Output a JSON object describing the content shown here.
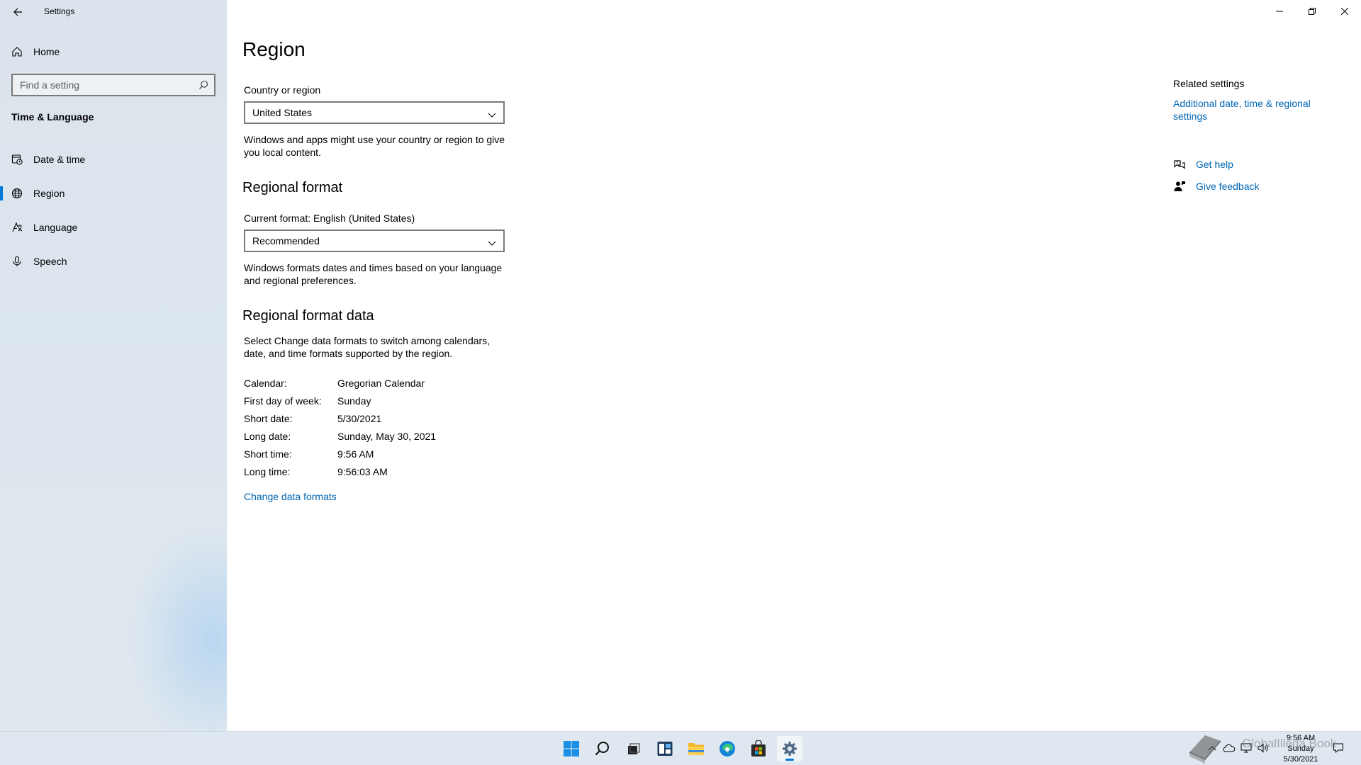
{
  "window": {
    "title": "Settings"
  },
  "sidebar": {
    "home_label": "Home",
    "search_placeholder": "Find a setting",
    "section_title": "Time & Language",
    "items": [
      {
        "label": "Date & time",
        "icon": "calendar-clock-icon"
      },
      {
        "label": "Region",
        "icon": "globe-icon",
        "active": true
      },
      {
        "label": "Language",
        "icon": "language-icon"
      },
      {
        "label": "Speech",
        "icon": "microphone-icon"
      }
    ]
  },
  "main": {
    "title": "Region",
    "country": {
      "label": "Country or region",
      "value": "United States",
      "description": "Windows and apps might use your country or region to give you local content."
    },
    "regional_format": {
      "title": "Regional format",
      "current_label": "Current format: English (United States)",
      "value": "Recommended",
      "description": "Windows formats dates and times based on your language and regional preferences."
    },
    "format_data": {
      "title": "Regional format data",
      "description": "Select Change data formats to switch among calendars, date, and time formats supported by the region.",
      "rows": [
        {
          "key": "Calendar:",
          "value": "Gregorian Calendar"
        },
        {
          "key": "First day of week:",
          "value": "Sunday"
        },
        {
          "key": "Short date:",
          "value": "5/30/2021"
        },
        {
          "key": "Long date:",
          "value": "Sunday, May 30, 2021"
        },
        {
          "key": "Short time:",
          "value": "9:56 AM"
        },
        {
          "key": "Long time:",
          "value": "9:56:03 AM"
        }
      ],
      "change_link": "Change data formats"
    }
  },
  "related": {
    "title": "Related settings",
    "link": "Additional date, time & regional settings",
    "get_help": "Get help",
    "give_feedback": "Give feedback"
  },
  "taskbar": {
    "clock_time": "9:56 AM",
    "clock_day": "Sunday",
    "clock_date": "5/30/2021",
    "watermark": "GlobalIlleda Book"
  },
  "colors": {
    "accent": "#0078d4",
    "link": "#0066b4"
  }
}
